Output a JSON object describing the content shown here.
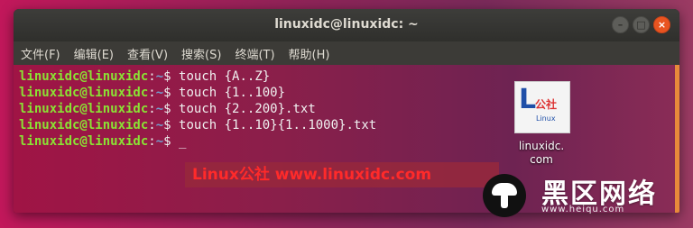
{
  "window": {
    "title": "linuxidc@linuxidc: ~",
    "buttons": [
      "–",
      "□",
      "×"
    ]
  },
  "menu": [
    "文件(F)",
    "编辑(E)",
    "查看(V)",
    "搜索(S)",
    "终端(T)",
    "帮助(H)"
  ],
  "terminal": {
    "user": "linuxidc@linuxidc",
    "path": "~",
    "lines": [
      "touch {A..Z}",
      "touch {1..100}",
      "touch {2..200}.txt",
      "touch {1..10}{1..1000}.txt",
      "_"
    ]
  },
  "watermark": "Linux公社 www.linuxidc.com",
  "desktop_icon": {
    "big": "L",
    "sub": "公社",
    "small": "Linux",
    "label_line1": "linuxidc.",
    "label_line2": "com"
  },
  "brand": {
    "name": "黑区网络",
    "url": "www.heiqu.com"
  }
}
